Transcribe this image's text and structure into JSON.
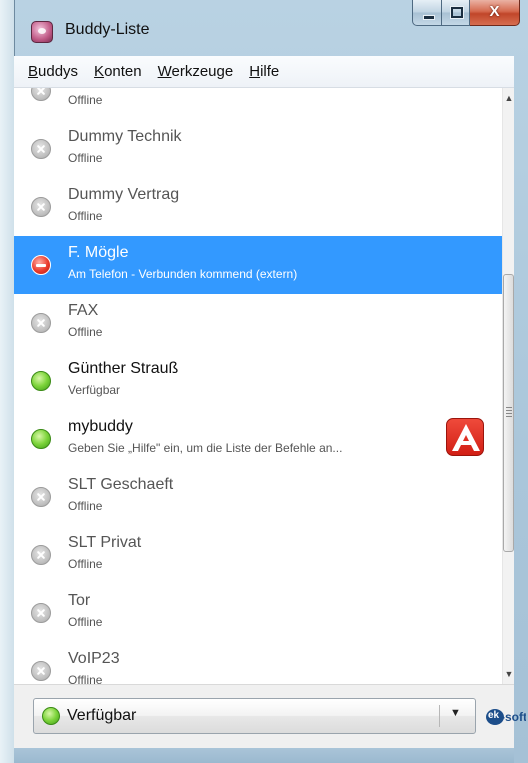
{
  "window": {
    "title": "Buddy-Liste",
    "close_glyph": "X"
  },
  "menu": [
    {
      "accel": "B",
      "rest": "uddys"
    },
    {
      "accel": "K",
      "rest": "onten"
    },
    {
      "accel": "W",
      "rest": "erkzeuge"
    },
    {
      "accel": "H",
      "rest": "ilfe"
    }
  ],
  "buddies": [
    {
      "name": "",
      "status_text": "Offline",
      "status": "offline"
    },
    {
      "name": "Dummy Technik",
      "status_text": "Offline",
      "status": "offline"
    },
    {
      "name": "Dummy Vertrag",
      "status_text": "Offline",
      "status": "offline"
    },
    {
      "name": "F. Mögle",
      "status_text": "Am Telefon - Verbunden kommend (extern)",
      "status": "busy",
      "selected": true
    },
    {
      "name": "FAX",
      "status_text": "Offline",
      "status": "offline"
    },
    {
      "name": "Günther Strauß",
      "status_text": "Verfügbar",
      "status": "available"
    },
    {
      "name": "mybuddy",
      "status_text": "Geben Sie „Hilfe\" ein, um die Liste der Befehle an...",
      "status": "available",
      "has_icon": true
    },
    {
      "name": "SLT Geschaeft",
      "status_text": "Offline",
      "status": "offline"
    },
    {
      "name": "SLT Privat",
      "status_text": "Offline",
      "status": "offline"
    },
    {
      "name": "Tor",
      "status_text": "Offline",
      "status": "offline"
    },
    {
      "name": "VoIP23",
      "status_text": "Offline",
      "status": "offline"
    }
  ],
  "status_selector": {
    "label": "Verfügbar",
    "status": "available"
  },
  "brand": {
    "mark": "ek",
    "text": "-soft"
  },
  "colors": {
    "selection": "#3399ff",
    "online_text": "#111111",
    "offline_text": "#555555"
  }
}
